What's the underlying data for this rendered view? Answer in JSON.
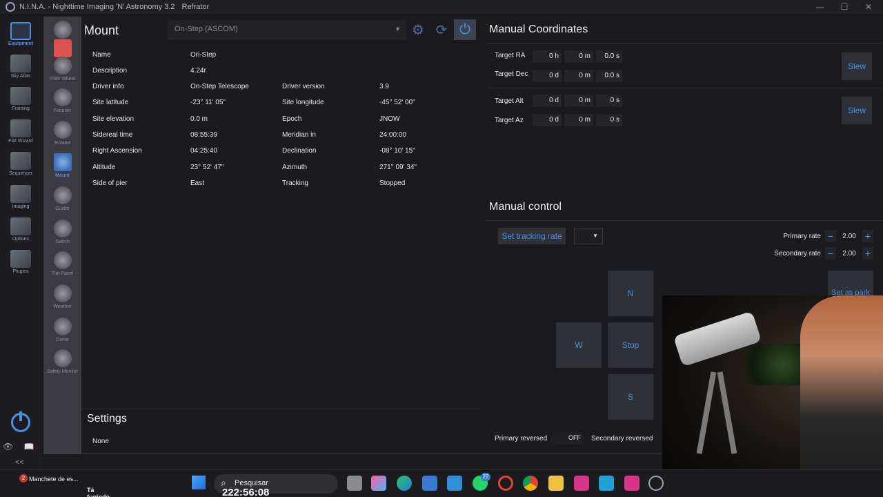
{
  "window": {
    "title": "N.I.N.A. - Nighttime Imaging 'N' Astronomy 3.2",
    "profile": "Refrator",
    "minimize": "—",
    "maximize": "☐",
    "close": "✕"
  },
  "leftnav": [
    {
      "label": "Equipment",
      "active": true
    },
    {
      "label": "Sky Atlas"
    },
    {
      "label": "Framing"
    },
    {
      "label": "Flat Wizard"
    },
    {
      "label": "Sequencer"
    },
    {
      "label": "Imaging"
    },
    {
      "label": "Options"
    },
    {
      "label": "Plugins"
    }
  ],
  "leftnav_bottom": {
    "icons": "👁 📖 ⓘ",
    "collapse": "<<"
  },
  "subnav": [
    {
      "label": ""
    },
    {
      "label": ""
    },
    {
      "label": "Filter Wheel"
    },
    {
      "label": "Focuser"
    },
    {
      "label": "Rotator"
    },
    {
      "label": "Mount",
      "active": true
    },
    {
      "label": "Guider"
    },
    {
      "label": "Switch"
    },
    {
      "label": "Flat Panel"
    },
    {
      "label": "Weather"
    },
    {
      "label": "Dome"
    },
    {
      "label": "Safety Monitor"
    }
  ],
  "mount": {
    "title": "Mount",
    "device": "On-Step (ASCOM)",
    "info": [
      {
        "k1": "Name",
        "v1": "On-Step",
        "k2": "",
        "v2": ""
      },
      {
        "k1": "Description",
        "v1": "4.24r",
        "k2": "",
        "v2": ""
      },
      {
        "k1": "Driver info",
        "v1": "On-Step Telescope",
        "k2": "Driver version",
        "v2": "3.9"
      },
      {
        "k1": "Site latitude",
        "v1": "-23° 11' 05\"",
        "k2": "Site longitude",
        "v2": "-45° 52' 00\""
      },
      {
        "k1": "Site elevation",
        "v1": "0.0 m",
        "k2": "Epoch",
        "v2": "JNOW"
      },
      {
        "k1": "Sidereal time",
        "v1": "08:55:39",
        "k2": "Meridian in",
        "v2": "24:00:00"
      },
      {
        "k1": "Right Ascension",
        "v1": "04:25:40",
        "k2": "Declination",
        "v2": "-08° 10' 15\""
      },
      {
        "k1": "Altitude",
        "v1": "23° 52' 47\"",
        "k2": "Azimuth",
        "v2": "271° 09' 34\""
      },
      {
        "k1": "Side of pier",
        "v1": "East",
        "k2": "Tracking",
        "v2": "Stopped"
      }
    ],
    "settings_title": "Settings",
    "settings_value": "None"
  },
  "manual_coordinates": {
    "title": "Manual Coordinates",
    "target_ra": {
      "label": "Target RA",
      "h": "0 h",
      "m": "0 m",
      "s": "0.0 s"
    },
    "target_dec": {
      "label": "Target Dec",
      "d": "0 d",
      "m": "0 m",
      "s": "0.0 s"
    },
    "target_alt": {
      "label": "Target Alt",
      "d": "0 d",
      "m": "0 m",
      "s": "0 s"
    },
    "target_az": {
      "label": "Target Az",
      "d": "0 d",
      "m": "0 m",
      "s": "0 s"
    },
    "slew_label": "Slew"
  },
  "manual_control": {
    "title": "Manual control",
    "set_tracking_rate": "Set tracking rate",
    "primary_rate_label": "Primary rate",
    "primary_rate": "2.00",
    "secondary_rate_label": "Secondary rate",
    "secondary_rate": "2.00",
    "north": "N",
    "west": "W",
    "stop": "Stop",
    "south": "S",
    "set_as_park": "Set as park",
    "primary_reversed_label": "Primary reversed",
    "primary_reversed_state": "OFF",
    "secondary_reversed_label": "Secondary reversed"
  },
  "taskbar": {
    "notif_line1": "Manchete de es...",
    "notif_line2": "Tá fugindo.....",
    "notif_count": "2",
    "search_placeholder": "Pesquisar",
    "clock": "222:56:08",
    "whatsapp_badge": "22"
  },
  "colors": {
    "accent": "#4a90e2",
    "background": "#1b1b1f",
    "panel": "#3a3a40"
  }
}
